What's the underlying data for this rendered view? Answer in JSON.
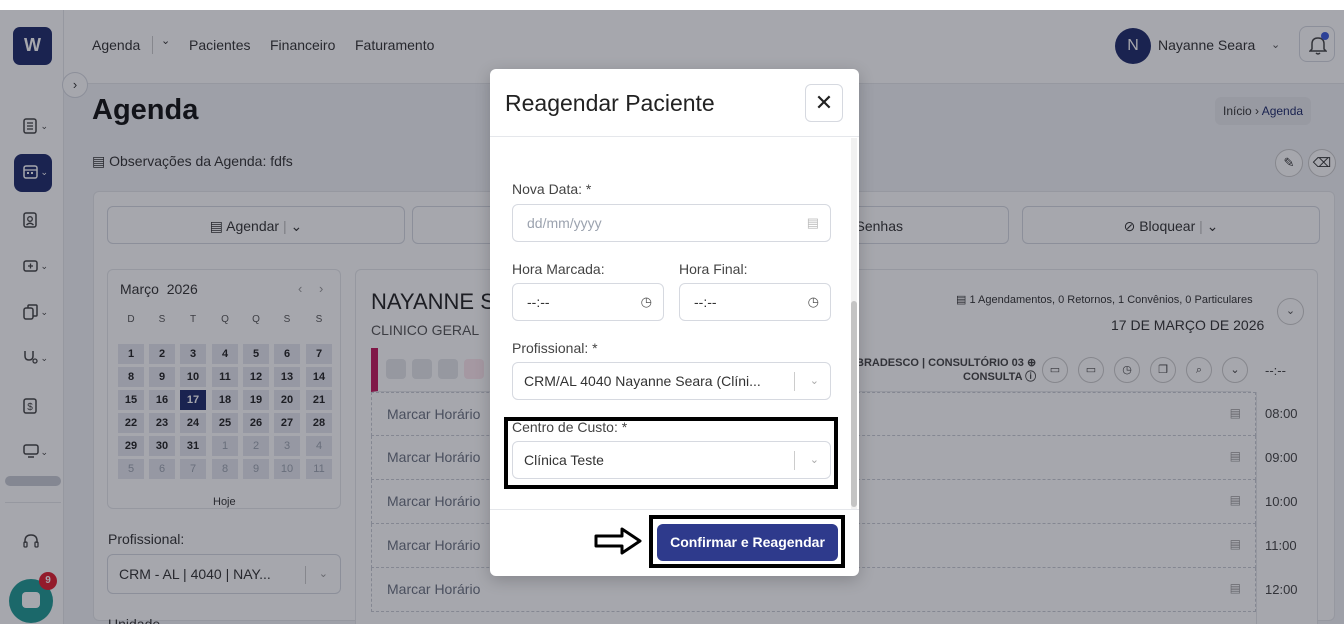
{
  "app": {
    "logo_text": "W"
  },
  "nav": {
    "agenda": "Agenda",
    "agenda_chev": "⌄",
    "pacientes": "Pacientes",
    "financeiro": "Financeiro",
    "faturamento": "Faturamento"
  },
  "user": {
    "initial": "N",
    "name": "Nayanne Seara",
    "chev": "⌄"
  },
  "sidebar": {
    "collapse": "›",
    "items": [
      "agenda-book-icon",
      "calendar-icon",
      "id-badge-icon",
      "medical-kit-icon",
      "documents-icon",
      "stethoscope-icon",
      "dollar-icon",
      "monitor-icon",
      "headset-icon"
    ]
  },
  "chat": {
    "badge": "9"
  },
  "page": {
    "title": "Agenda",
    "obs": "Observações da Agenda: fdfs",
    "edit": "✎",
    "erase": "⌫"
  },
  "breadcrumb": {
    "home": "Início",
    "sep": "›",
    "current": "Agenda"
  },
  "actions": {
    "agendar": "Agendar",
    "senhas": "Senhas",
    "bloquear": "Bloquear",
    "chev": "⌄"
  },
  "calendar": {
    "month": "Março",
    "year": "2026",
    "prev": "‹",
    "next": "›",
    "dow": [
      "D",
      "S",
      "T",
      "Q",
      "Q",
      "S",
      "S"
    ],
    "weeks": [
      [
        "1",
        "2",
        "3",
        "4",
        "5",
        "6",
        "7"
      ],
      [
        "8",
        "9",
        "10",
        "11",
        "12",
        "13",
        "14"
      ],
      [
        "15",
        "16",
        "17",
        "18",
        "19",
        "20",
        "21"
      ],
      [
        "22",
        "23",
        "24",
        "25",
        "26",
        "27",
        "28"
      ],
      [
        "29",
        "30",
        "31",
        "1",
        "2",
        "3",
        "4"
      ],
      [
        "5",
        "6",
        "7",
        "8",
        "9",
        "10",
        "11"
      ]
    ],
    "selected": "17",
    "today_label": "Hoje"
  },
  "filters": {
    "prof_label": "Profissional:",
    "prof_value": "CRM - AL | 4040 | NAY...",
    "unid_label": "Unidade"
  },
  "schedule": {
    "name": "NAYANNE S",
    "specialty": "CLINICO GERAL",
    "stats": "1 Agendamentos, 0 Retornos, 1 Convênios, 0 Particulares",
    "date": "17 DE MARÇO DE 2026",
    "info_line1": "BRADESCO | CONSULTÓRIO 03 ⊕",
    "info_line2": "CONSULTA ⓘ",
    "empty_time": "--:--",
    "slot_label": "Marcar Horário",
    "times": [
      "08:00",
      "09:00",
      "10:00",
      "11:00",
      "12:00"
    ]
  },
  "modal": {
    "title": "Reagendar Paciente",
    "close": "✕",
    "date_label": "Nova Data: *",
    "date_placeholder": "dd/mm/yyyy",
    "hora_marcada_label": "Hora Marcada:",
    "hora_marcada_value": "--:--",
    "hora_final_label": "Hora Final:",
    "hora_final_value": "--:--",
    "prof_label": "Profissional: *",
    "prof_value": "CRM/AL 4040 Nayanne Seara (Clíni...",
    "centro_label": "Centro de Custo: *",
    "centro_value": "Clínica Teste",
    "confirm": "Confirmar e Reagendar"
  }
}
